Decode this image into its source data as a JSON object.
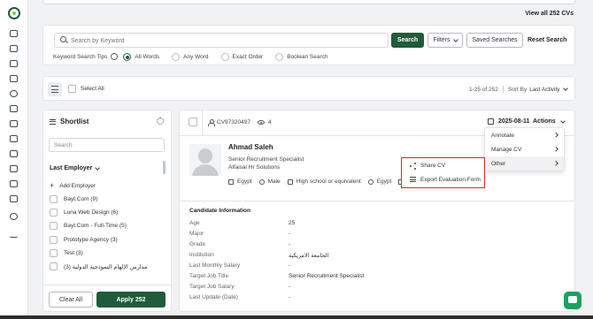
{
  "header": {
    "view_all": "View all 252 CVs"
  },
  "search": {
    "placeholder": "Search by Keyword",
    "search_button": "Search",
    "filters_button": "Filters",
    "saved_button": "Saved Searches",
    "reset_link": "Reset Search",
    "tips_label": "Keyword Search Tips",
    "options": [
      "All Words",
      "Any Word",
      "Exact Order",
      "Boolean Search"
    ],
    "selected_option": "All Words"
  },
  "toolbar": {
    "select_all": "Select All",
    "range": "1-25 of 252",
    "sort_label": "Sort By",
    "sort_value": "Last Activity"
  },
  "shortlist": {
    "title": "Shortlist",
    "search_placeholder": "Search",
    "group_title": "Last Employer",
    "add_label": "Add Employer",
    "items": [
      "Bayt.Com (9)",
      "Luna Web Design (6)",
      "Bayt.Com - Full-Time (5)",
      "Prototype Agency (3)",
      "Test (3)",
      "مدارس الإلهام النموذجية الدولية (3)"
    ],
    "clear_button": "Clear All",
    "apply_button": "Apply 252"
  },
  "cv": {
    "id": "CV97320497",
    "views": "4",
    "date": "2025-08-11",
    "actions_label": "Actions",
    "name": "Ahmad Saleh",
    "title": "Senior Recruitment Specialist",
    "company": "Alfaisal Hr Solutions",
    "tags": [
      "Egypt",
      "Male",
      "High school or equivalent",
      "Egypt"
    ],
    "section_title": "Candidate Information",
    "info": [
      {
        "k": "Age",
        "v": "25"
      },
      {
        "k": "Major",
        "v": "-"
      },
      {
        "k": "Grade",
        "v": "-"
      },
      {
        "k": "Institution",
        "v": "الجامعة الامريكية"
      },
      {
        "k": "Last Monthly Salary",
        "v": "-"
      },
      {
        "k": "Target Job Title",
        "v": "Senior Recruitment Specialist"
      },
      {
        "k": "Target Job Salary",
        "v": "-"
      },
      {
        "k": "Last Update (Date)",
        "v": "-"
      }
    ]
  },
  "actions_menu": {
    "items": [
      "Annotate",
      "Manage CV",
      "Other"
    ],
    "active": "Other",
    "submenu": [
      "Share CV",
      "Export Evaluation Form"
    ]
  },
  "colors": {
    "brand": "#1f5c3a",
    "highlight": "#e0242b",
    "chat": "#1aa260"
  }
}
